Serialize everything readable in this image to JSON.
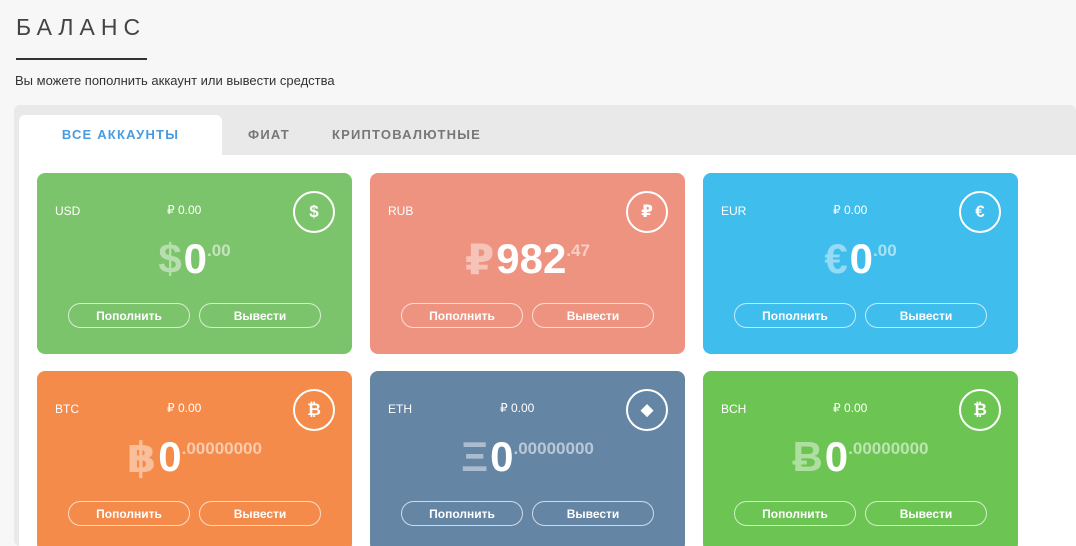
{
  "header": {
    "title": "БАЛАНС",
    "subtitle": "Вы можете пополнить аккаунт или вывести средства"
  },
  "tabs": [
    {
      "label": "ВСЕ АККАУНТЫ",
      "active": true
    },
    {
      "label": "ФИАТ",
      "active": false
    },
    {
      "label": "КРИПТОВАЛЮТНЫЕ",
      "active": false
    }
  ],
  "cards": [
    {
      "code": "USD",
      "rub_equiv": "₽ 0.00",
      "icon": "dollar-icon",
      "icon_glyph": "$",
      "symbol": "$",
      "int": "0",
      "frac": ".00",
      "deposit": "Пополнить",
      "withdraw": "Вывести",
      "color": "#7cc46c"
    },
    {
      "code": "RUB",
      "rub_equiv": "",
      "icon": "ruble-icon",
      "icon_glyph": "₽",
      "symbol": "₽",
      "int": "982",
      "frac": ".47",
      "deposit": "Пополнить",
      "withdraw": "Вывести",
      "color": "#ee9380"
    },
    {
      "code": "EUR",
      "rub_equiv": "₽ 0.00",
      "icon": "euro-icon",
      "icon_glyph": "€",
      "symbol": "€",
      "int": "0",
      "frac": ".00",
      "deposit": "Пополнить",
      "withdraw": "Вывести",
      "color": "#3fbded"
    },
    {
      "code": "BTC",
      "rub_equiv": "₽ 0.00",
      "icon": "bitcoin-icon",
      "icon_glyph": "₿",
      "symbol": "฿",
      "int": "0",
      "frac": ".00000000",
      "deposit": "Пополнить",
      "withdraw": "Вывести",
      "color": "#f48b4a"
    },
    {
      "code": "ETH",
      "rub_equiv": "₽ 0.00",
      "icon": "ethereum-icon",
      "icon_glyph": "◆",
      "symbol": "Ξ",
      "int": "0",
      "frac": ".00000000",
      "deposit": "Пополнить",
      "withdraw": "Вывести",
      "color": "#6585a5"
    },
    {
      "code": "BCH",
      "rub_equiv": "₽ 0.00",
      "icon": "bitcoin-cash-icon",
      "icon_glyph": "₿",
      "symbol": "Ƀ",
      "int": "0",
      "frac": ".00000000",
      "deposit": "Пополнить",
      "withdraw": "Вывести",
      "color": "#6cc552"
    }
  ]
}
